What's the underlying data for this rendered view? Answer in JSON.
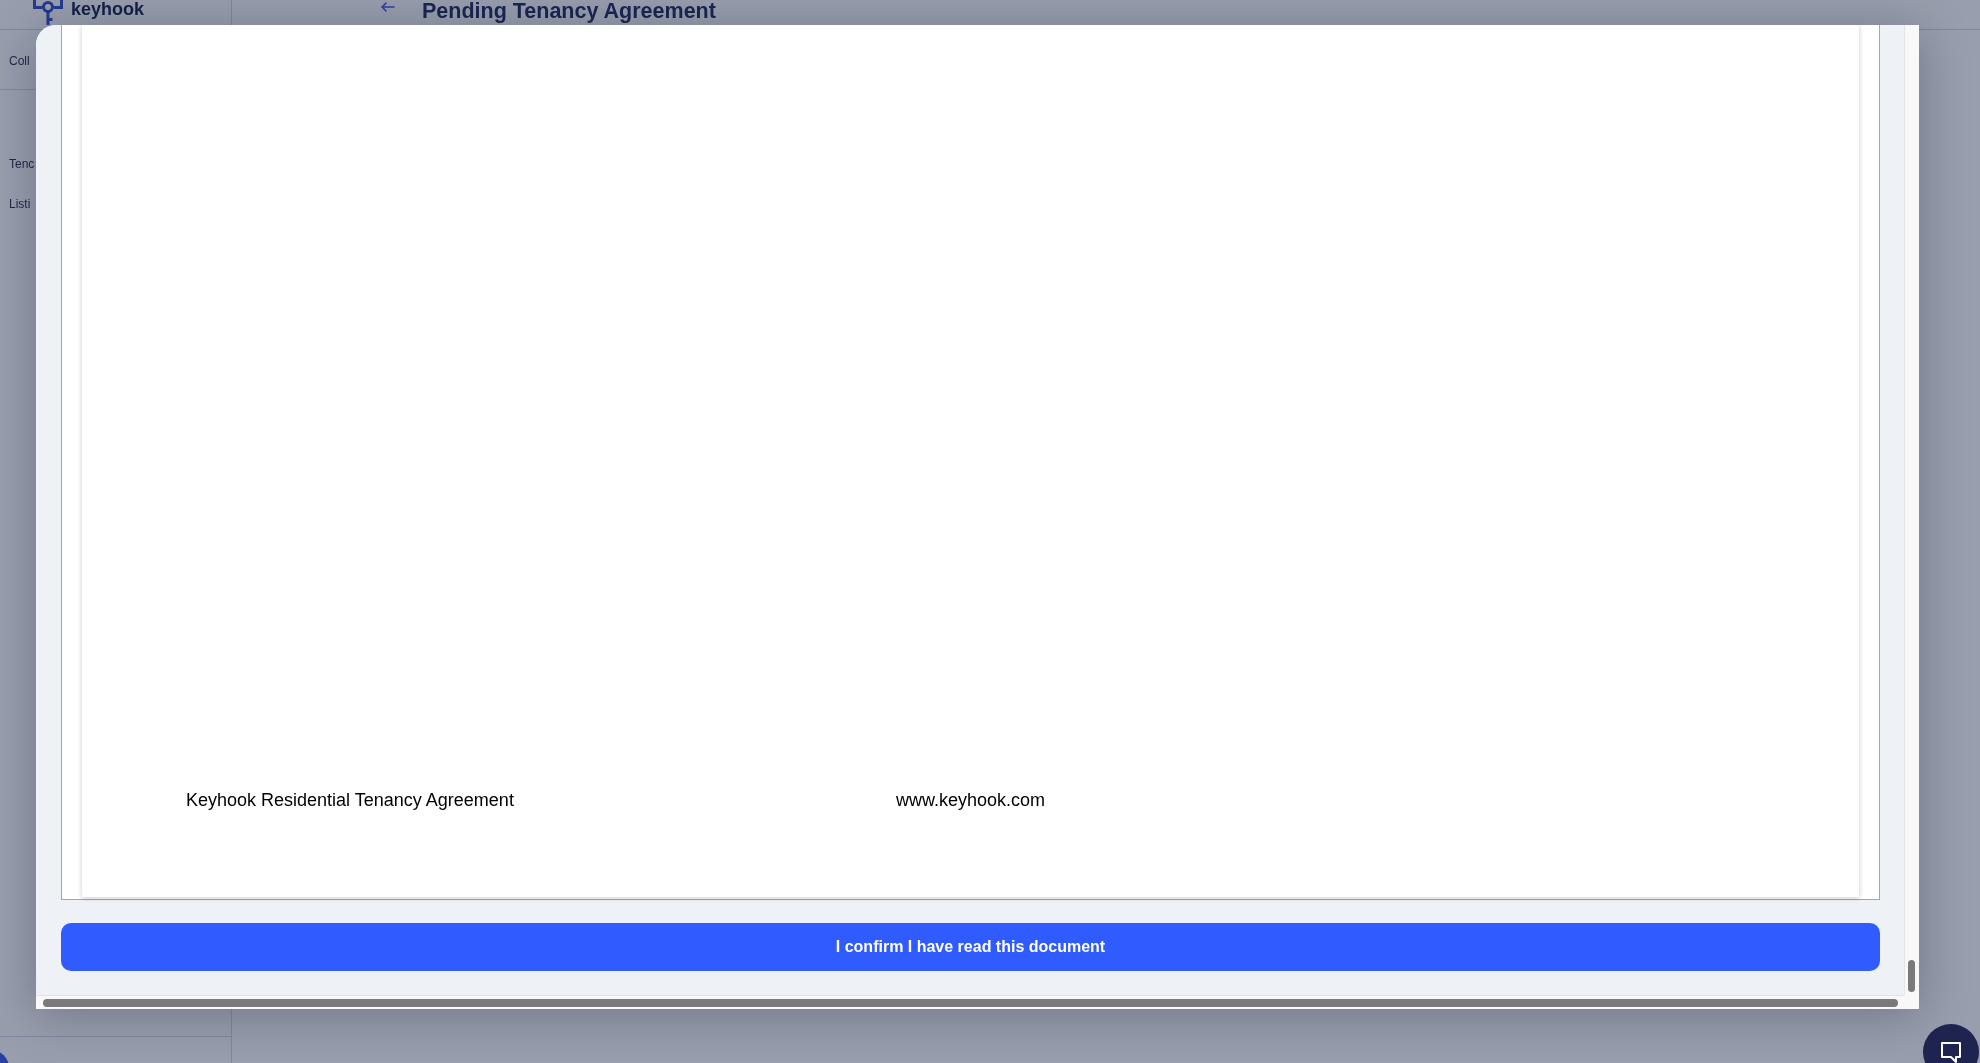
{
  "app": {
    "logo": {
      "name": "keyhook"
    },
    "page_title": "Pending Tenancy Agreement"
  },
  "sidebar": {
    "top_item": "Coll",
    "nav_items": [
      "Tenc",
      "Listi"
    ]
  },
  "modal": {
    "document": {
      "footer_left": "Keyhook Residential Tenancy Agreement",
      "footer_right": "www.keyhook.com"
    },
    "confirm_button": "I confirm I have read this document"
  }
}
